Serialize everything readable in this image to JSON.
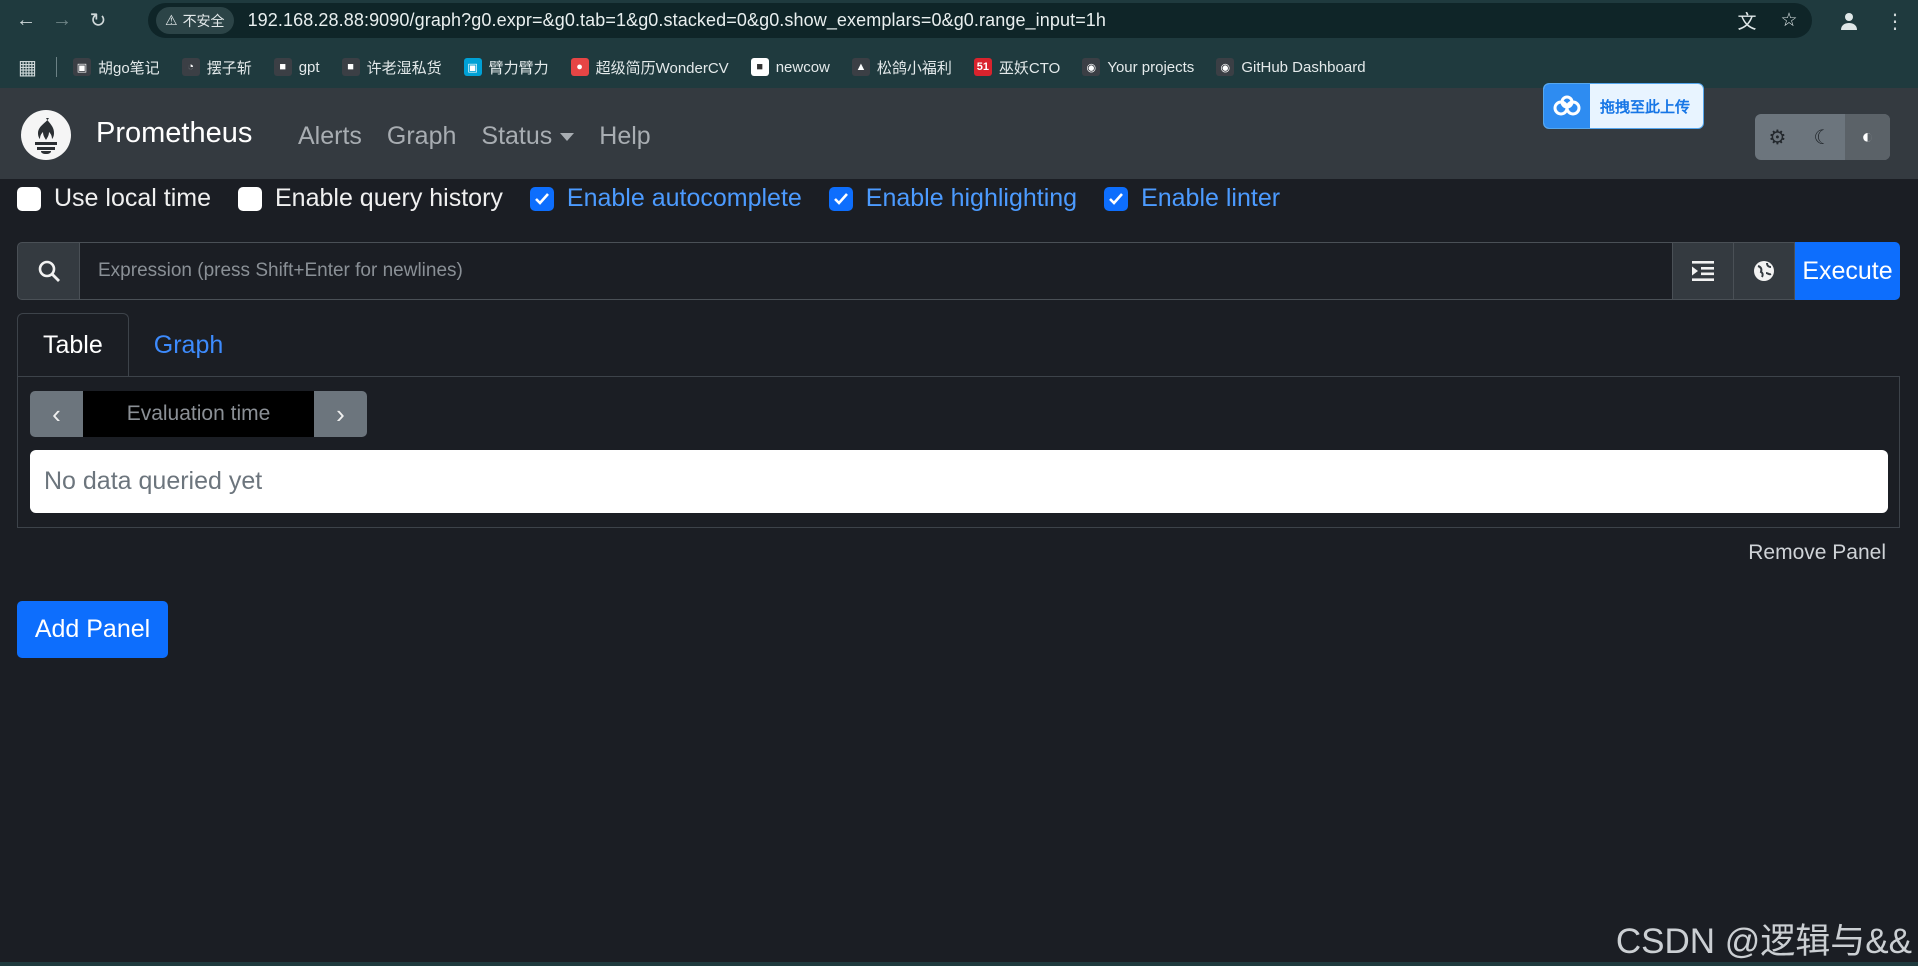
{
  "browser": {
    "insecure_label": "不安全",
    "url": "192.168.28.88:9090/graph?g0.expr=&g0.tab=1&g0.stacked=0&g0.show_exemplars=0&g0.range_input=1h",
    "bookmarks": [
      {
        "label": "胡go笔记",
        "icon": "book-icon",
        "color": "#3b3f45"
      },
      {
        "label": "摆子斩",
        "icon": "globe-icon",
        "color": "#3b3f45"
      },
      {
        "label": "gpt",
        "icon": "folder-icon",
        "color": "#3b3f45"
      },
      {
        "label": "许老湿私货",
        "icon": "folder-icon",
        "color": "#3b3f45"
      },
      {
        "label": "臂力臂力",
        "icon": "bilibili-icon",
        "color": "#00a1d6"
      },
      {
        "label": "超级简历WonderCV",
        "icon": "wondercv-icon",
        "color": "#e64545"
      },
      {
        "label": "newcow",
        "icon": "newcow-icon",
        "color": "#ffffff"
      },
      {
        "label": "松鸽小福利",
        "icon": "pigeon-icon",
        "color": "#3b3f45"
      },
      {
        "label": "巫妖CTO",
        "icon": "51cto-icon",
        "color": "#d9232d"
      },
      {
        "label": "Your projects",
        "icon": "github-icon",
        "color": "#3b3f45"
      },
      {
        "label": "GitHub Dashboard",
        "icon": "github-icon",
        "color": "#3b3f45"
      }
    ]
  },
  "navbar": {
    "brand": "Prometheus",
    "links": [
      "Alerts",
      "Graph",
      "Status",
      "Help"
    ]
  },
  "upload": {
    "label": "拖拽至此上传"
  },
  "settings": [
    {
      "label": "Use local time",
      "checked": false
    },
    {
      "label": "Enable query history",
      "checked": false
    },
    {
      "label": "Enable autocomplete",
      "checked": true
    },
    {
      "label": "Enable highlighting",
      "checked": true
    },
    {
      "label": "Enable linter",
      "checked": true
    }
  ],
  "query": {
    "placeholder": "Expression (press Shift+Enter for newlines)",
    "value": "",
    "execute_label": "Execute"
  },
  "tabs": [
    "Table",
    "Graph"
  ],
  "panel": {
    "evaluation_placeholder": "Evaluation time",
    "no_data": "No data queried yet",
    "remove_label": "Remove Panel"
  },
  "add_panel_label": "Add Panel",
  "watermark": "CSDN @逻辑与&&",
  "colors": {
    "primary": "#0d6efd",
    "navbar": "#343a40",
    "background": "#1b1e24"
  }
}
